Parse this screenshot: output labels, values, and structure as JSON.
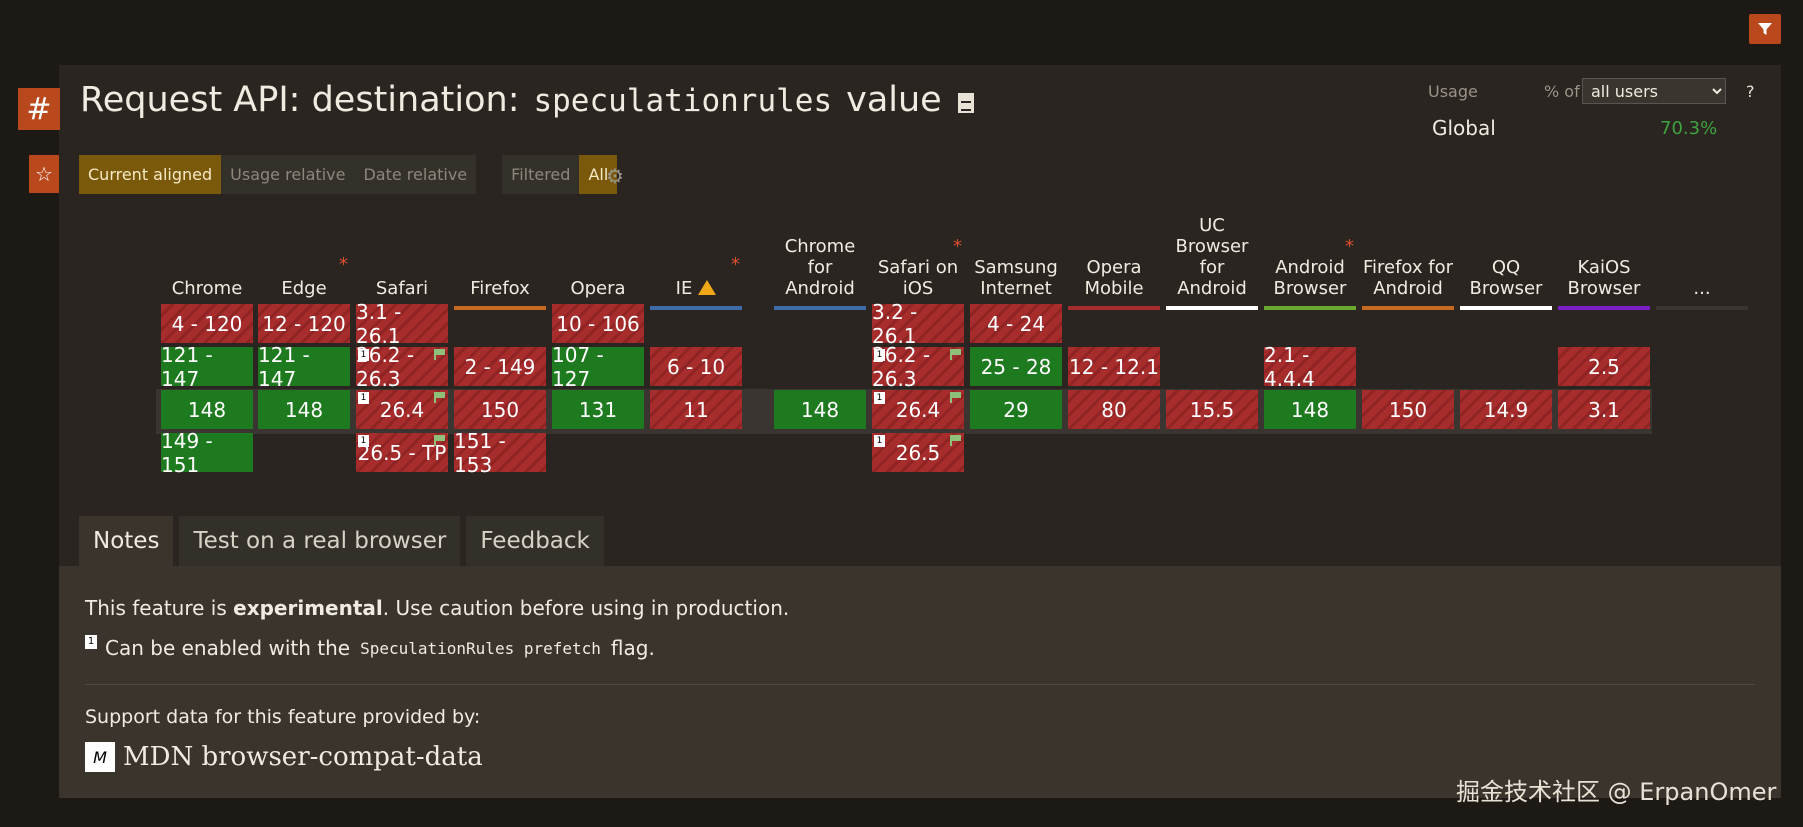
{
  "title": {
    "prefix": "Request API: destination:",
    "code": "speculationrules",
    "suffix": "value"
  },
  "usage": {
    "label": "Usage",
    "pct_of": "% of",
    "selected": "all users",
    "help": "?",
    "global_label": "Global",
    "global_value": "70.3%"
  },
  "toggles": {
    "current_aligned": "Current aligned",
    "usage_relative": "Usage relative",
    "date_relative": "Date relative",
    "filtered": "Filtered",
    "all": "All"
  },
  "browsers": [
    {
      "name": "Chrome",
      "bar": "#3d6ca8",
      "asterisk": ""
    },
    {
      "name": "Edge",
      "bar": "#3d6ca8",
      "asterisk": "*"
    },
    {
      "name": "Safari",
      "bar": "#3d6ca8",
      "asterisk": ""
    },
    {
      "name": "Firefox",
      "bar": "#c56a1f",
      "asterisk": ""
    },
    {
      "name": "Opera",
      "bar": "#3d6ca8",
      "asterisk": ""
    },
    {
      "name": "IE",
      "bar": "#3d6ca8",
      "asterisk": "*"
    },
    {
      "name": "Chrome for Android",
      "bar": "#3d6ca8",
      "asterisk": ""
    },
    {
      "name": "Safari on iOS",
      "bar": "#555049",
      "asterisk": "*"
    },
    {
      "name": "Samsung Internet",
      "bar": "#8a3dd1",
      "asterisk": ""
    },
    {
      "name": "Opera Mobile",
      "bar": "#a32d2d",
      "asterisk": ""
    },
    {
      "name": "UC Browser for Android",
      "bar": "#ffffff",
      "asterisk": ""
    },
    {
      "name": "Android Browser",
      "bar": "#6aa832",
      "asterisk": "*"
    },
    {
      "name": "Firefox for Android",
      "bar": "#c56a1f",
      "asterisk": ""
    },
    {
      "name": "QQ Browser",
      "bar": "#ffffff",
      "asterisk": ""
    },
    {
      "name": "KaiOS Browser",
      "bar": "#7a1fc5",
      "asterisk": ""
    },
    {
      "name": "...",
      "bar": "#3a3530",
      "asterisk": ""
    }
  ],
  "cells": [
    {
      "label": "4 - 120",
      "s": "n"
    },
    {
      "label": "121 - 147",
      "s": "y"
    },
    {
      "label": "148",
      "s": "y"
    },
    {
      "label": "149 - 151",
      "s": "y"
    },
    {
      "label": "12 - 120",
      "s": "n"
    },
    {
      "label": "121 - 147",
      "s": "y"
    },
    {
      "label": "148",
      "s": "y"
    },
    {
      "label": "3.1 - 26.1",
      "s": "n"
    },
    {
      "label": "26.2 - 26.3",
      "s": "n",
      "note": "1"
    },
    {
      "label": "26.4",
      "s": "n",
      "note": "1"
    },
    {
      "label": "26.5 - TP",
      "s": "n",
      "note": "1"
    },
    {
      "label": "2 - 149",
      "s": "n"
    },
    {
      "label": "150",
      "s": "n"
    },
    {
      "label": "151 - 153",
      "s": "n"
    },
    {
      "label": "10 - 106",
      "s": "n"
    },
    {
      "label": "107 - 127",
      "s": "y"
    },
    {
      "label": "131",
      "s": "y"
    },
    {
      "label": "6 - 10",
      "s": "n"
    },
    {
      "label": "11",
      "s": "n"
    },
    {
      "label": "148",
      "s": "y"
    },
    {
      "label": "3.2 - 26.1",
      "s": "n"
    },
    {
      "label": "26.2 - 26.3",
      "s": "n",
      "note": "1"
    },
    {
      "label": "26.4",
      "s": "n",
      "note": "1"
    },
    {
      "label": "26.5",
      "s": "n",
      "note": "1"
    },
    {
      "label": "4 - 24",
      "s": "n"
    },
    {
      "label": "25 - 28",
      "s": "y"
    },
    {
      "label": "29",
      "s": "y"
    },
    {
      "label": "12 - 12.1",
      "s": "n"
    },
    {
      "label": "80",
      "s": "n"
    },
    {
      "label": "15.5",
      "s": "n"
    },
    {
      "label": "2.1 - 4.4.4",
      "s": "n"
    },
    {
      "label": "148",
      "s": "y"
    },
    {
      "label": "150",
      "s": "n"
    },
    {
      "label": "14.9",
      "s": "n"
    },
    {
      "label": "2.5",
      "s": "n"
    },
    {
      "label": "3.1",
      "s": "n"
    }
  ],
  "tabs": {
    "notes": "Notes",
    "test": "Test on a real browser",
    "feedback": "Feedback"
  },
  "notes": {
    "line1_pre": "This feature is ",
    "line1_bold": "experimental",
    "line1_post": ". Use caution before using in production.",
    "fn_marker": "1",
    "line2_pre": "Can be enabled with the",
    "line2_code": "SpeculationRules prefetch",
    "line2_post": "flag.",
    "support_label": "Support data for this feature provided by:",
    "mdn_logo": "M",
    "mdn_text": "MDN browser-compat-data"
  },
  "watermark": "掘金技术社区 @ ErpanOmer",
  "icons": {
    "filter": "filter-icon",
    "hash": "hash-icon",
    "star": "star-icon",
    "gear": "gear-icon",
    "doc": "document-icon"
  },
  "colors": {
    "supported": "#1e7a1e",
    "unsupported": "#a72c2c",
    "accent": "#b9491c"
  }
}
